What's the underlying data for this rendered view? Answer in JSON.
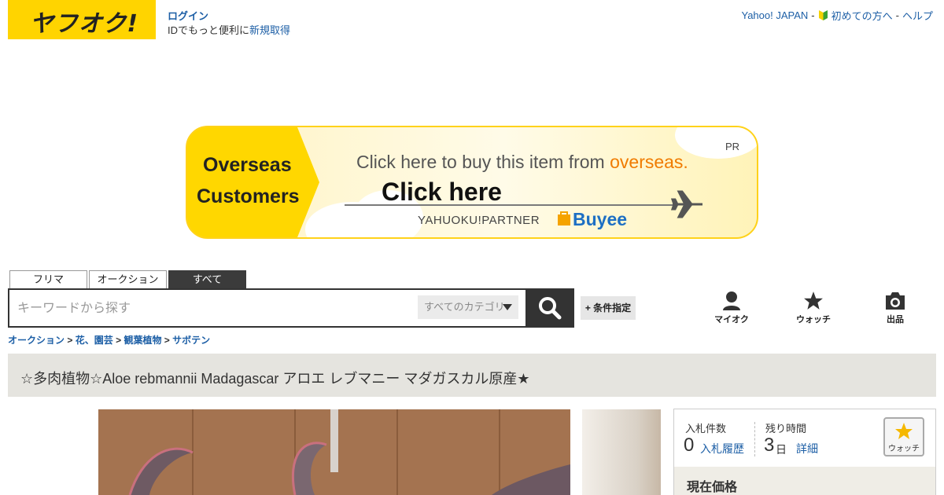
{
  "header": {
    "logo_text": "ヤフオク!",
    "login_label": "ログイン",
    "signup_prefix": "IDでもっと便利に",
    "signup_link": "新規取得",
    "links": {
      "yahoo_japan": "Yahoo! JAPAN",
      "sep1": "-",
      "beginners": "初めての方へ",
      "sep2": "-",
      "help": "ヘルプ"
    }
  },
  "banner": {
    "line1": "Overseas",
    "line2": "Customers",
    "message_prefix": "Click here to buy this item from ",
    "message_highlight": "overseas.",
    "click_here": "Click here",
    "partner": "YAHUOKU!PARTNER",
    "buyee": "Buyee",
    "pr": "PR"
  },
  "search": {
    "tabs": [
      "フリマ",
      "オークション",
      "すべて"
    ],
    "active_tab": "すべて",
    "placeholder": "キーワードから探す",
    "category_value": "すべてのカテゴリ",
    "conditions_label": "+ 条件指定"
  },
  "nav": {
    "myauction": "マイオク",
    "watch": "ウォッチ",
    "sell": "出品"
  },
  "breadcrumb": {
    "items": [
      "オークション",
      "花、園芸",
      "観葉植物",
      "サボテン"
    ],
    "separator": ">"
  },
  "item": {
    "title": "☆多肉植物☆Aloe rebmannii Madagascar アロエ レブマニー マダガスカル原産★"
  },
  "bid_panel": {
    "bid_count_label": "入札件数",
    "bid_count": "0",
    "bid_history_link": "入札履歴",
    "time_left_label": "残り時間",
    "time_left_value": "3",
    "time_left_unit": "日",
    "detail_link": "詳細",
    "watch_label": "ウォッチ",
    "current_price_label": "現在価格"
  },
  "colors": {
    "brand_yellow": "#ffd400",
    "link_blue": "#1d5fa6",
    "dark": "#333333",
    "accent_orange": "#f07b00"
  }
}
